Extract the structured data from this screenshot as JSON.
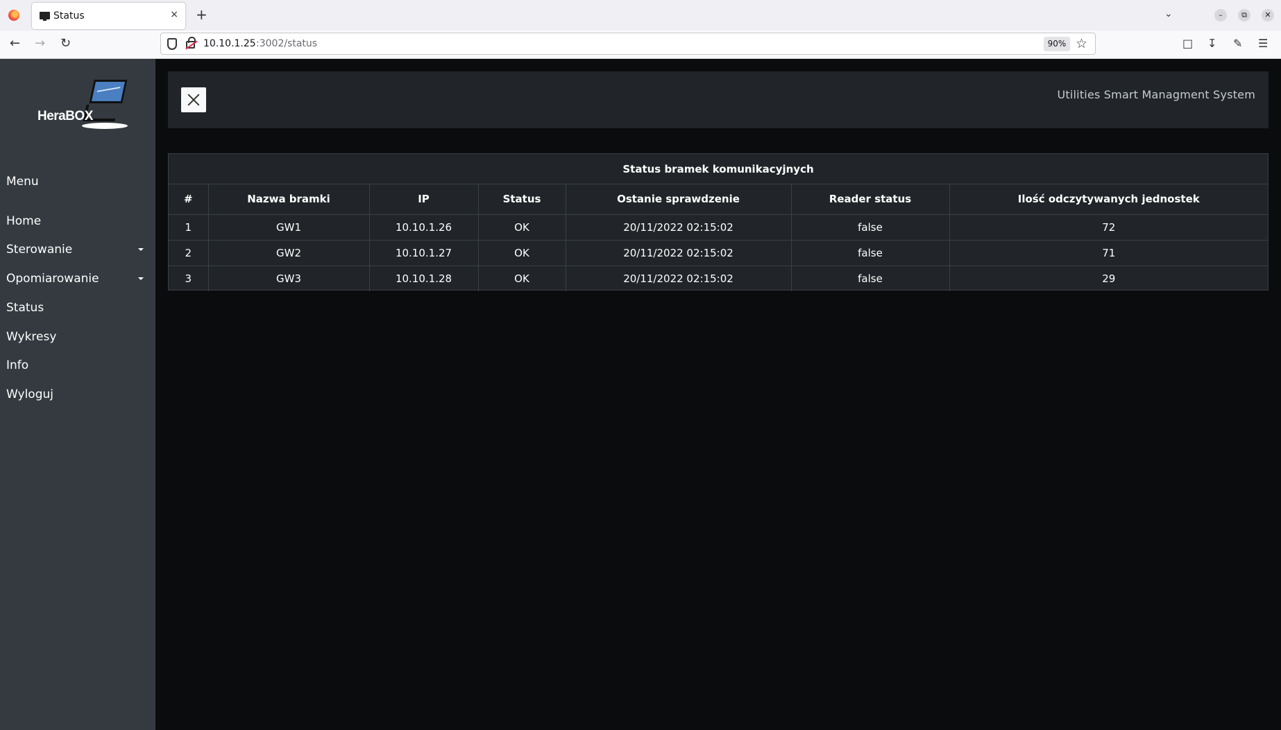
{
  "browser": {
    "tab_title": "Status",
    "tab_close": "×",
    "new_tab": "+",
    "url_host": "10.10.1.25",
    "url_rest": ":3002/status",
    "zoom": "90%"
  },
  "sidebar": {
    "logo_text": "HeraBOX",
    "menu_heading": "Menu",
    "items": [
      {
        "label": "Home"
      },
      {
        "label": "Sterowanie"
      },
      {
        "label": "Opomiarowanie"
      },
      {
        "label": "Status"
      },
      {
        "label": "Wykresy"
      },
      {
        "label": "Info"
      },
      {
        "label": "Wyloguj"
      }
    ]
  },
  "header": {
    "brand": "Utilities Smart Managment System"
  },
  "table": {
    "caption": "Status bramek komunikacyjnych",
    "columns": [
      "#",
      "Nazwa bramki",
      "IP",
      "Status",
      "Ostanie sprawdzenie",
      "Reader status",
      "Ilość odczytywanych jednostek"
    ],
    "rows": [
      [
        "1",
        "GW1",
        "10.10.1.26",
        "OK",
        "20/11/2022 02:15:02",
        "false",
        "72"
      ],
      [
        "2",
        "GW2",
        "10.10.1.27",
        "OK",
        "20/11/2022 02:15:02",
        "false",
        "71"
      ],
      [
        "3",
        "GW3",
        "10.10.1.28",
        "OK",
        "20/11/2022 02:15:02",
        "false",
        "29"
      ]
    ]
  }
}
